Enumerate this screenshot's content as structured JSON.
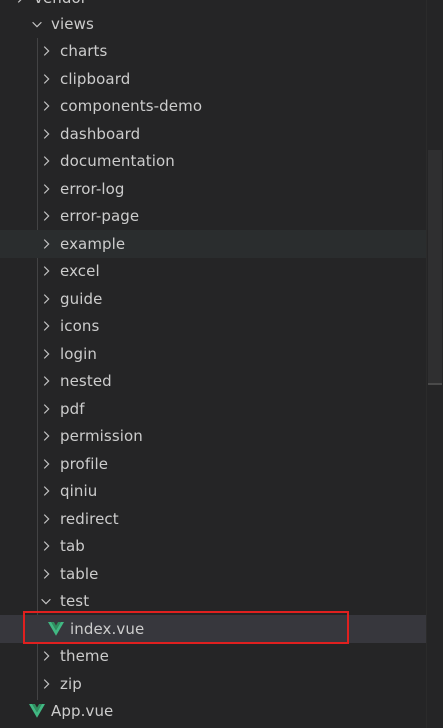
{
  "colors": {
    "background": "#252526",
    "text": "#cccccc",
    "chevron": "#c5c5c5",
    "vue_green": "#41b883",
    "vue_dark": "#35495e",
    "selected_bg": "#37373d",
    "hover_bg": "#2a2d2e",
    "highlight_border": "#e0201f"
  },
  "tree": {
    "top_partial": "vendor",
    "views_folder": "views",
    "folders": [
      "charts",
      "clipboard",
      "components-demo",
      "dashboard",
      "documentation",
      "error-log",
      "error-page",
      "example",
      "excel",
      "guide",
      "icons",
      "login",
      "nested",
      "pdf",
      "permission",
      "profile",
      "qiniu",
      "redirect",
      "tab",
      "table"
    ],
    "test_folder": "test",
    "test_file": "index.vue",
    "after_folders": [
      "theme",
      "zip"
    ],
    "root_file": "App.vue"
  }
}
